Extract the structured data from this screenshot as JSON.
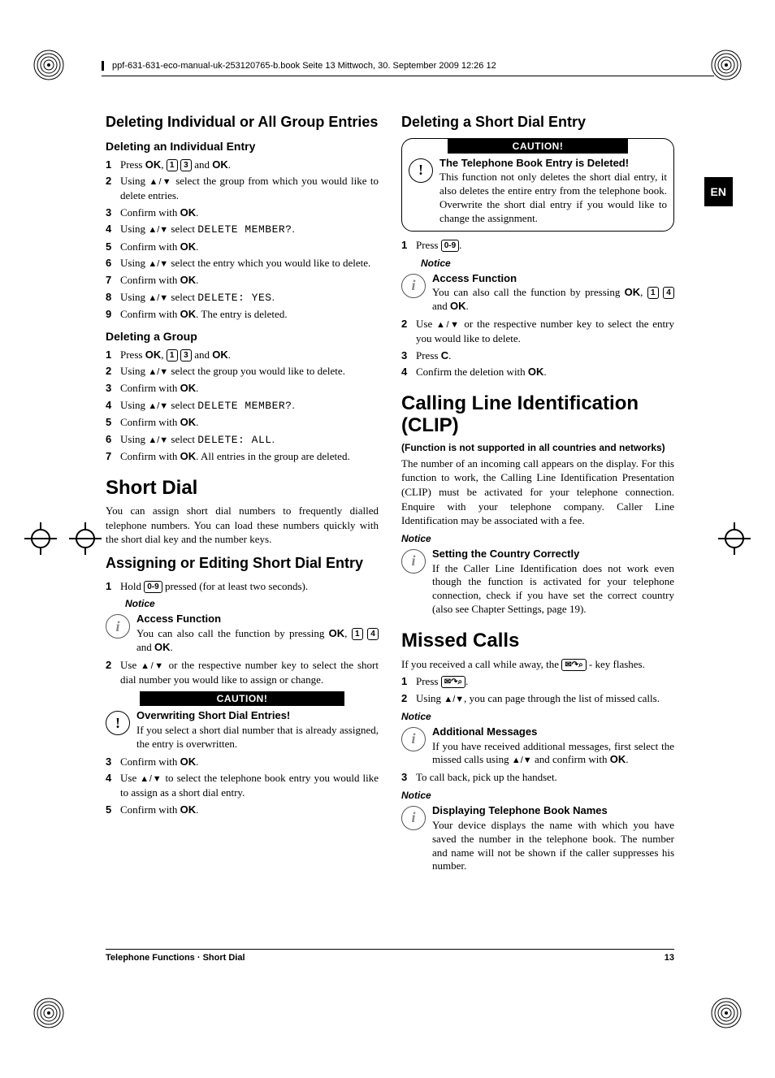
{
  "header": "ppf-631-631-eco-manual-uk-253120765-b.book  Seite 13  Mittwoch, 30. September 2009  12:26 12",
  "lang_tab": "EN",
  "left": {
    "h_del_group": "Deleting Individual or All Group Entries",
    "h_del_indiv": "Deleting an Individual Entry",
    "steps_indiv": [
      "Press <span class='ok'>OK</span>, <span class='key'>1</span> <span class='key'>3</span> and <span class='ok'>OK</span>.",
      "Using <span class='arrows'>▲/▼</span> select the group from which you would like to delete entries.",
      "Confirm with <span class='ok'>OK</span>.",
      "Using <span class='arrows'>▲/▼</span> select <span class='mono'>DELETE MEMBER?</span>.",
      "Confirm with <span class='ok'>OK</span>.",
      "Using <span class='arrows'>▲/▼</span> select the entry which you would like to delete.",
      "Confirm with <span class='ok'>OK</span>.",
      "Using <span class='arrows'>▲/▼</span> select <span class='mono'>DELETE: YES</span>.",
      "Confirm with <span class='ok'>OK</span>. The entry is deleted."
    ],
    "h_del_grp": "Deleting a Group",
    "steps_grp": [
      "Press <span class='ok'>OK</span>, <span class='key'>1</span> <span class='key'>3</span> and <span class='ok'>OK</span>.",
      "Using <span class='arrows'>▲/▼</span> select the group you would like to delete.",
      "Confirm with <span class='ok'>OK</span>.",
      "Using <span class='arrows'>▲/▼</span> select <span class='mono'>DELETE MEMBER?</span>.",
      "Confirm with <span class='ok'>OK</span>.",
      "Using <span class='arrows'>▲/▼</span> select <span class='mono'>DELETE: ALL</span>.",
      "Confirm with <span class='ok'>OK</span>. All entries in the group are deleted."
    ],
    "h_short": "Short Dial",
    "p_short": "You can assign short dial numbers to frequently dialled telephone numbers. You can load these numbers quickly with the short dial key and the number keys.",
    "h_assign": "Assigning or Editing Short Dial Entry",
    "steps_assign_a": [
      "Hold <span class='key'>0-9</span> pressed (for at least two seconds)."
    ],
    "notice": "Notice",
    "access_title": "Access Function",
    "access_body": "You can also call the function by pressing <span class='ok'>OK</span>, <span class='key'>1</span> <span class='key'>4</span> and <span class='ok'>OK</span>.",
    "steps_assign_b": [
      "Use <span class='arrows'>▲/▼</span> or the respective number key to select the short dial number you would like to assign or change."
    ],
    "caution": "CAUTION!",
    "overwrite_title": "Overwriting Short Dial Entries!",
    "overwrite_body": "If you select a short dial number that is already assigned, the entry is overwritten.",
    "steps_assign_c": [
      "Confirm with <span class='ok'>OK</span>.",
      "Use <span class='arrows'>▲/▼</span> to select the telephone book entry you would like to assign as a short dial entry.",
      "Confirm with <span class='ok'>OK</span>."
    ]
  },
  "right": {
    "h_del_short": "Deleting a Short Dial Entry",
    "caution": "CAUTION!",
    "deleted_title": "The Telephone Book Entry is Deleted!",
    "deleted_body": "This function not only deletes the short dial entry, it also deletes the entire entry from the telephone book. Overwrite the short dial entry if you would like to change the assignment.",
    "steps_del_a": [
      "Press <span class='key'>0-9</span>."
    ],
    "notice": "Notice",
    "access_title": "Access Function",
    "access_body": "You can also call the function by pressing <span class='ok'>OK</span>, <span class='key'>1</span> <span class='key'>4</span> and <span class='ok'>OK</span>.",
    "steps_del_b": [
      "Use <span class='arrows'>▲/▼</span> or the respective number key to select the entry you would like to delete.",
      "Press <span class='ok'>C</span>.",
      "Confirm the deletion with <span class='ok'>OK</span>."
    ],
    "h_clip": "Calling Line Identification (CLIP)",
    "clip_sub": "(Function is not supported in all countries and networks)",
    "clip_body": "The number of an incoming call appears on the display. For this function to work, the Calling Line Identification Presentation (CLIP) must be activated for your telephone connection. Enquire with your telephone company. Caller Line Identification may be associated with a fee.",
    "country_title": "Setting the Country Correctly",
    "country_body": "If the Caller Line Identification does not work even though the function is activated for your telephone connection, check if you have set the correct country (also see Chapter Settings, page 19).",
    "h_missed": "Missed Calls",
    "missed_intro": "If you received a call while away, the <span class='key'>✉↷⌕</span> - key flashes.",
    "steps_missed_a": [
      "Press <span class='key'>✉↷⌕</span>.",
      "Using <span class='arrows'>▲/▼</span>, you can page through the list of missed calls."
    ],
    "addl_title": "Additional Messages",
    "addl_body": "If you have received additional messages, first select the missed calls using <span class='arrows'>▲/▼</span> and confirm with <span class='ok'>OK</span>.",
    "steps_missed_b": [
      "To call back, pick up the handset."
    ],
    "names_title": "Displaying Telephone Book Names",
    "names_body": "Your device displays the name with which you have saved the number in the telephone book. The number and name will not be shown if the caller suppresses his number."
  },
  "footer": {
    "left": "Telephone Functions  ·  Short Dial",
    "right": "13"
  }
}
